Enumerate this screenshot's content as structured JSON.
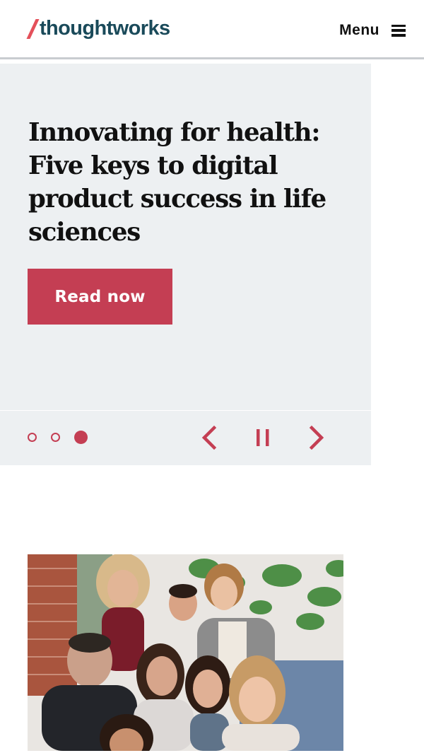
{
  "header": {
    "logo_text": "thoughtworks",
    "menu_label": "Menu",
    "menu_icon": "hamburger-icon"
  },
  "hero": {
    "title": "Innovating for health: Five keys to digital product success in life sciences",
    "cta_label": "Read now"
  },
  "carousel": {
    "slide_count": 3,
    "active_slide": 3,
    "controls": [
      "chevron-left-icon",
      "pause-icon",
      "chevron-right-icon"
    ]
  },
  "colors": {
    "accent": "#c43e53",
    "logo_slash": "#e4505a",
    "logo_text": "#1a4a5a",
    "hero_bg": "#edf0f2",
    "header_border": "#c9ccd0"
  },
  "photo": {
    "subject": "group-photo"
  }
}
